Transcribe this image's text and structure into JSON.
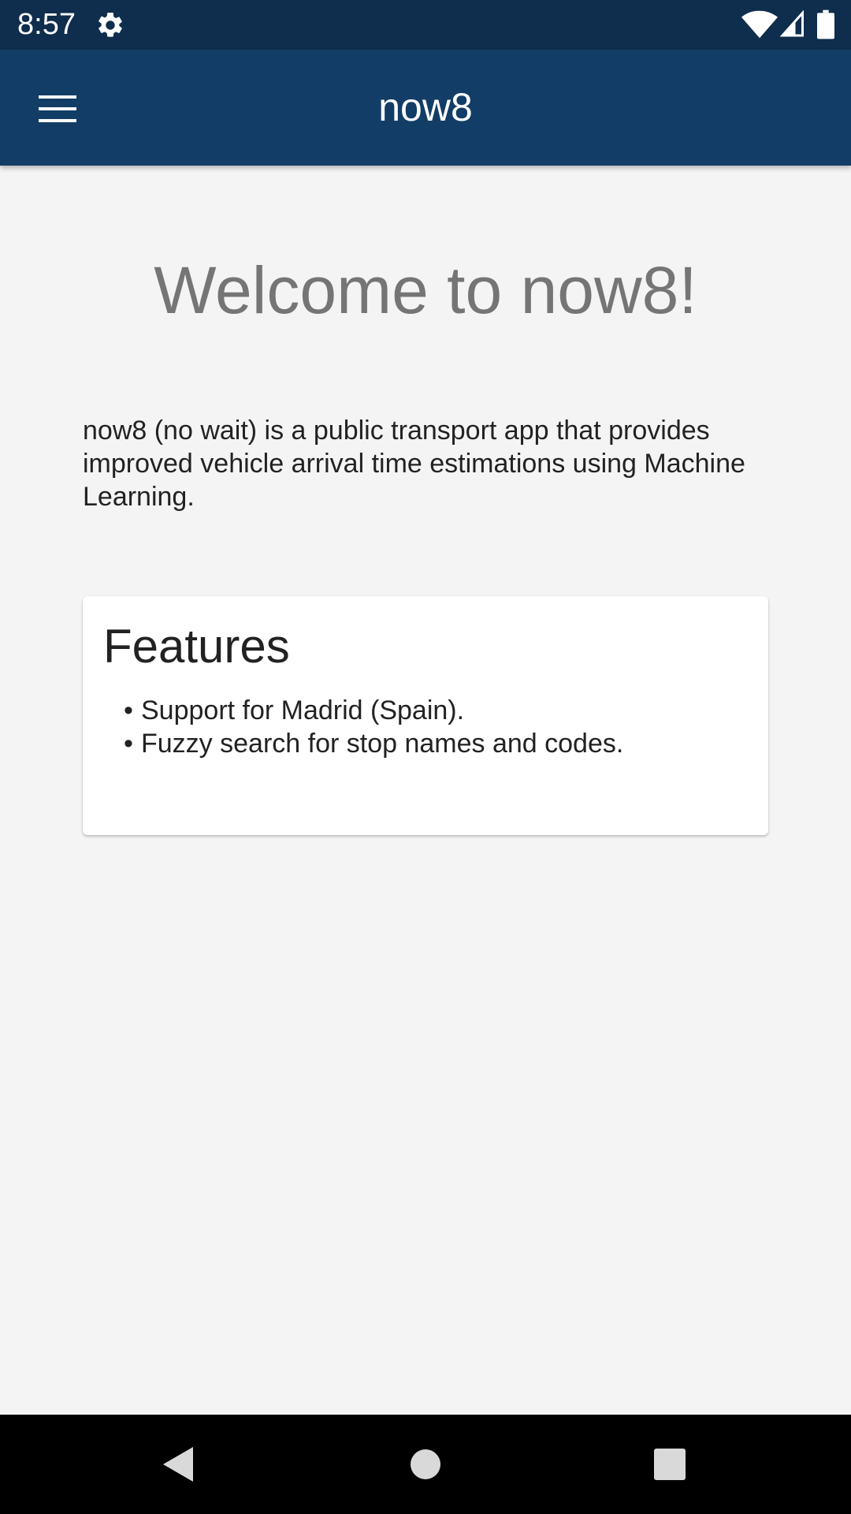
{
  "status_bar": {
    "time": "8:57",
    "icons": [
      "settings-gear-icon",
      "wifi-icon",
      "cell-signal-icon",
      "battery-icon"
    ]
  },
  "app_bar": {
    "title": "now8",
    "menu_icon": "hamburger-menu-icon"
  },
  "main": {
    "welcome_heading": "Welcome to now8!",
    "intro_text": "now8 (no wait) is a public transport app that provides improved vehicle arrival time estimations using Machine Learning.",
    "features": {
      "title": "Features",
      "bullet": "•",
      "items": [
        "Support for Madrid (Spain).",
        "Fuzzy search for stop names and codes."
      ]
    }
  },
  "nav_bar": {
    "buttons": [
      "back-icon",
      "home-icon",
      "recents-icon"
    ]
  },
  "colors": {
    "status_bar_bg": "#0f2d4d",
    "app_bar_bg": "#123d66",
    "page_bg": "#f4f4f4",
    "heading_text": "#757575",
    "body_text": "#222222"
  }
}
